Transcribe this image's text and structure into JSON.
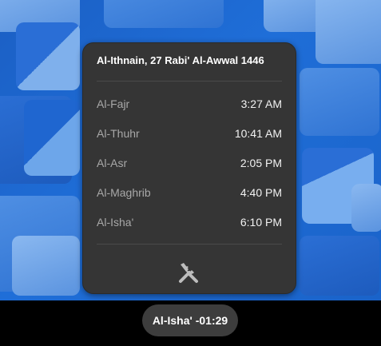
{
  "popup": {
    "title": "Al-Ithnain, 27 Rabi' Al-Awwal 1446",
    "prayers": [
      {
        "name": "Al-Fajr",
        "time": "3:27 AM"
      },
      {
        "name": "Al-Thuhr",
        "time": "10:41 AM"
      },
      {
        "name": "Al-Asr",
        "time": "2:05 PM"
      },
      {
        "name": "Al-Maghrib",
        "time": "4:40 PM"
      },
      {
        "name": "Al-Isha'",
        "time": "6:10 PM"
      }
    ],
    "settings_icon": "tools-icon"
  },
  "panel": {
    "indicator_label": "Al-Isha' -01:29"
  },
  "colors": {
    "popup_bg": "#353535",
    "panel_bg": "#000000",
    "pill_bg": "#3d3d3d",
    "wallpaper": "#1f6ed8"
  }
}
